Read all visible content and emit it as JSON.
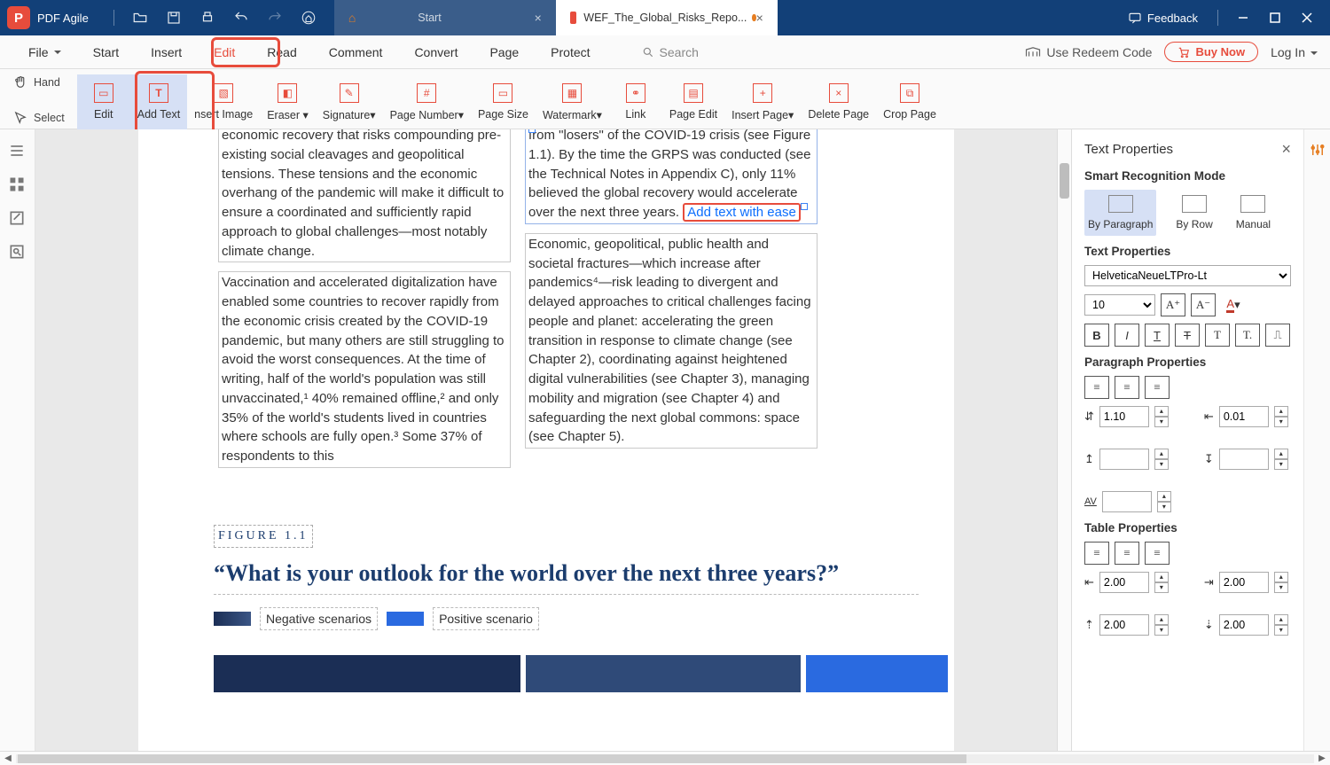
{
  "app": {
    "name": "PDF Agile"
  },
  "titlebar": {
    "feedback": "Feedback",
    "tabs": {
      "start": "Start",
      "doc": "WEF_The_Global_Risks_Repo..."
    }
  },
  "menu": {
    "file": "File",
    "start": "Start",
    "insert": "Insert",
    "edit": "Edit",
    "read": "Read",
    "comment": "Comment",
    "convert": "Convert",
    "page": "Page",
    "protect": "Protect",
    "search_placeholder": "Search",
    "redeem": "Use Redeem Code",
    "buy": "Buy Now",
    "login": "Log In"
  },
  "ribbon": {
    "hand": "Hand",
    "select": "Select",
    "edit": "Edit",
    "addtext": "Add Text",
    "insertimage": "nsert Image",
    "eraser": "Eraser",
    "signature": "Signature",
    "pagenumber": "Page Number",
    "pagesize": "Page Size",
    "watermark": "Watermark",
    "link": "Link",
    "pageedit": "Page Edit",
    "insertpage": "Insert Page",
    "deletepage": "Delete Page",
    "croppage": "Crop Page"
  },
  "doc": {
    "leftA": "economic recovery that risks compounding pre-existing social cleavages and geopolitical tensions. These tensions and the economic overhang of the pandemic will make it difficult to ensure a coordinated and sufficiently rapid approach to global challenges—most notably climate change.",
    "leftB": "Vaccination and accelerated digitalization have enabled some countries to recover rapidly from the economic crisis created by the COVID-19 pandemic, but many others are still struggling to avoid the worst consequences. At the time of writing, half of the world's population was still unvaccinated,¹ 40% remained offline,² and only 35% of the world's students lived in countries where schools are fully open.³ Some 37% of respondents to this",
    "rightA_pre": "from \"losers\" of the COVID-19 crisis (see Figure 1.1). By the time the GRPS was conducted (see the Technical Notes in Appendix C), only 11% believed the global recovery would accelerate over the next three years. ",
    "rightA_ins": "Add text with ease",
    "rightB": "Economic, geopolitical, public health and societal fractures—which increase after pandemics⁴—risk leading to divergent and delayed approaches to critical challenges facing people and planet: accelerating the green transition in response to climate change (see Chapter 2), coordinating against heightened digital vulnerabilities (see Chapter 3), managing mobility and migration (see Chapter 4) and safeguarding the next global commons: space (see Chapter 5).",
    "figcap": "FIGURE 1.1",
    "figtitle": "“What is your outlook for the world over the next three years?”",
    "legend_neg": "Negative scenarios",
    "legend_pos": "Positive scenario"
  },
  "panel": {
    "head": "Text Properties",
    "smart": "Smart Recognition Mode",
    "mode_para": "By Paragraph",
    "mode_row": "By Row",
    "mode_manual": "Manual",
    "textprops": "Text Properties",
    "font": "HelveticaNeueLTPro-Lt",
    "fontsize": "10",
    "paraprops": "Paragraph Properties",
    "line_spacing": "1.10",
    "indent": "0.01",
    "tableprops": "Table Properties",
    "t_a": "2.00",
    "t_b": "2.00",
    "t_c": "2.00",
    "t_d": "2.00"
  }
}
